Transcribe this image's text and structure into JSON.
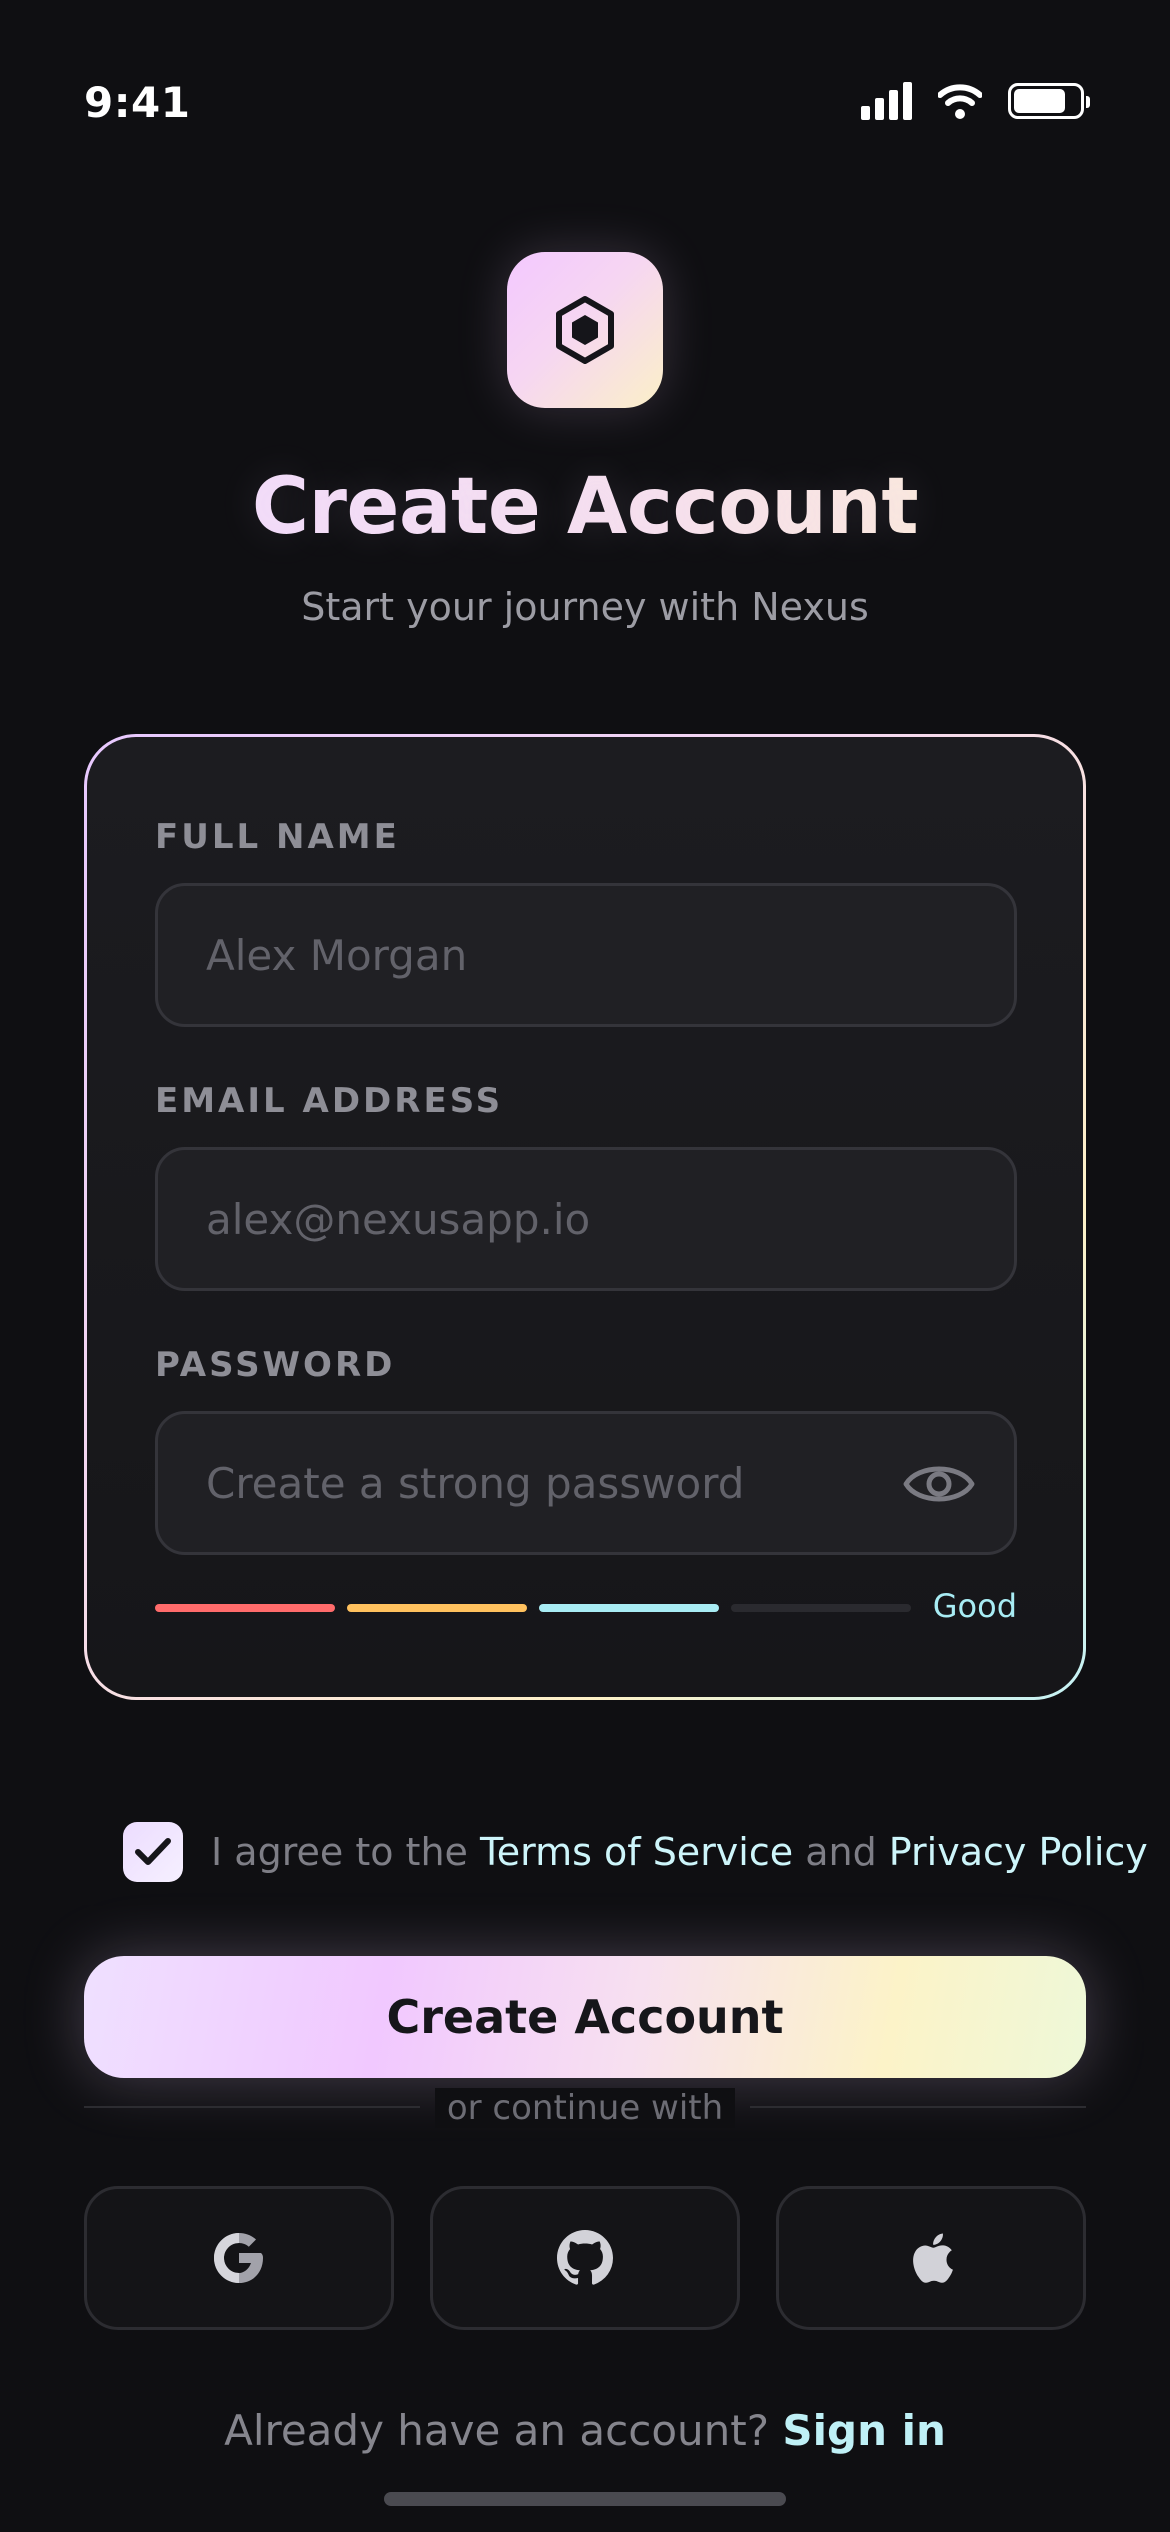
{
  "status_bar": {
    "time": "9:41"
  },
  "header": {
    "logo_icon": "hexagon-icon",
    "title": "Create Account",
    "subtitle": "Start your journey with Nexus"
  },
  "form": {
    "full_name": {
      "label": "FULL NAME",
      "value": "",
      "placeholder": "Alex Morgan"
    },
    "email": {
      "label": "EMAIL ADDRESS",
      "value": "",
      "placeholder": "alex@nexusapp.io"
    },
    "password": {
      "label": "PASSWORD",
      "value": "",
      "placeholder": "Create a strong password",
      "toggle_icon": "eye-icon",
      "strength": {
        "label": "Good",
        "level": 3,
        "max": 4,
        "colors": [
          "#ff6b6b",
          "#ffc15e",
          "#a8ecf4",
          "#2a2a2f"
        ]
      }
    }
  },
  "terms": {
    "checked": true,
    "prefix": "I agree to the ",
    "tos_label": "Terms of Service",
    "and": " and ",
    "privacy_label": "Privacy Policy"
  },
  "primary_button": {
    "label": "Create Account"
  },
  "divider": {
    "text": "or continue with"
  },
  "social": [
    {
      "name": "google",
      "icon": "google-icon"
    },
    {
      "name": "github",
      "icon": "github-icon"
    },
    {
      "name": "apple",
      "icon": "apple-icon"
    }
  ],
  "footer": {
    "prompt": "Already have an account? ",
    "link": "Sign in"
  },
  "colors": {
    "accent_cyan": "#bff0f6",
    "accent_pink": "#f1c8ff",
    "accent_yellow": "#fcf3c8",
    "background": "#0f0f12"
  }
}
